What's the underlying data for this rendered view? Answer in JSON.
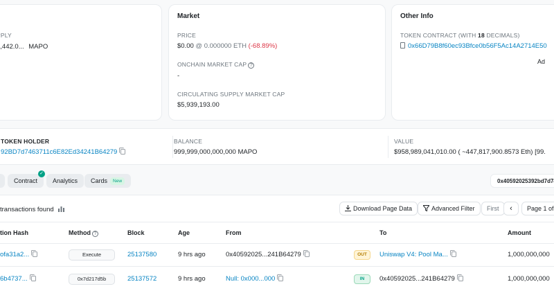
{
  "overview": {
    "supply_label": "PPLY",
    "supply_value": "4,442.0...",
    "supply_symbol": "MAPO"
  },
  "market": {
    "title": "Market",
    "price_label": "PRICE",
    "price_usd": "$0.00",
    "price_eth": "@ 0.000000 ETH",
    "price_change": "(-68.89%)",
    "onchain_cap_label": "ONCHAIN MARKET CAP",
    "onchain_cap_value": "-",
    "circ_cap_label": "CIRCULATING SUPPLY MARKET CAP",
    "circ_cap_value": "$5,939,193.00"
  },
  "other_info": {
    "title": "Other Info",
    "contract_label_pre": "TOKEN CONTRACT (WITH ",
    "contract_decimals": "18",
    "contract_label_post": " DECIMALS)",
    "contract_address": "0x66D79B8f60ec93Bfce0b56F5Ac14A2714E50",
    "ad_label": "Ad"
  },
  "holder": {
    "label": "TOKEN HOLDER",
    "address": "92BD7d7463711c6E82Ed34241B64279",
    "balance_label": "BALANCE",
    "balance_value": "999,999,000,000,000 MAPO",
    "value_label": "VALUE",
    "value_value": "$958,989,041,010.00 ( ~447,817,900.8573 Eth) [99."
  },
  "tabs": {
    "contract": "Contract",
    "analytics": "Analytics",
    "cards": "Cards",
    "cards_badge": "New",
    "address_chip": "0x40592025392bd7d74"
  },
  "toolbar": {
    "found_text": "transactions found",
    "download": "Download Page Data",
    "filter": "Advanced Filter",
    "first": "First",
    "prev": "‹",
    "page": "Page 1 of"
  },
  "table": {
    "headers": {
      "hash": "tion Hash",
      "method": "Method",
      "block": "Block",
      "age": "Age",
      "from": "From",
      "to": "To",
      "amount": "Amount"
    },
    "rows": [
      {
        "hash": "ofa31a2...",
        "method": "Execute",
        "block": "25137580",
        "age": "9 hrs ago",
        "from": "0x40592025...241B64279",
        "dir": "OUT",
        "to": "Uniswap V4: Pool Ma...",
        "amount": "1,000,000,000"
      },
      {
        "hash": "6b4737...",
        "method": "0x7d217d5b",
        "block": "25137572",
        "age": "9 hrs ago",
        "from": "Null: 0x000...000",
        "dir": "IN",
        "to": "0x40592025...241B64279",
        "amount": "1,000,000,000"
      }
    ]
  },
  "colors": {
    "link": "#0784c3",
    "negative": "#dc3545",
    "success": "#00a186"
  }
}
